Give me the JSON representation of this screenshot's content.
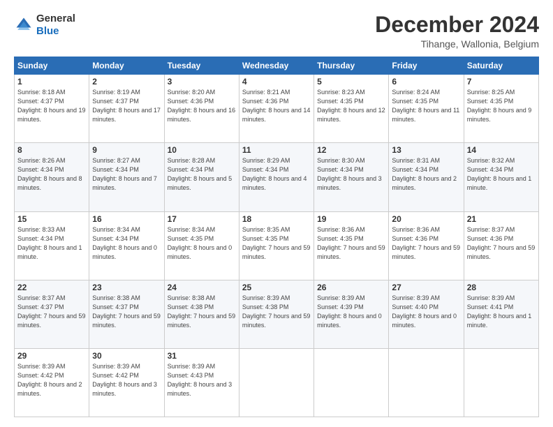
{
  "logo": {
    "general": "General",
    "blue": "Blue"
  },
  "header": {
    "month": "December 2024",
    "location": "Tihange, Wallonia, Belgium"
  },
  "days_of_week": [
    "Sunday",
    "Monday",
    "Tuesday",
    "Wednesday",
    "Thursday",
    "Friday",
    "Saturday"
  ],
  "weeks": [
    [
      {
        "day": "1",
        "sunrise": "8:18 AM",
        "sunset": "4:37 PM",
        "daylight": "8 hours and 19 minutes."
      },
      {
        "day": "2",
        "sunrise": "8:19 AM",
        "sunset": "4:37 PM",
        "daylight": "8 hours and 17 minutes."
      },
      {
        "day": "3",
        "sunrise": "8:20 AM",
        "sunset": "4:36 PM",
        "daylight": "8 hours and 16 minutes."
      },
      {
        "day": "4",
        "sunrise": "8:21 AM",
        "sunset": "4:36 PM",
        "daylight": "8 hours and 14 minutes."
      },
      {
        "day": "5",
        "sunrise": "8:23 AM",
        "sunset": "4:35 PM",
        "daylight": "8 hours and 12 minutes."
      },
      {
        "day": "6",
        "sunrise": "8:24 AM",
        "sunset": "4:35 PM",
        "daylight": "8 hours and 11 minutes."
      },
      {
        "day": "7",
        "sunrise": "8:25 AM",
        "sunset": "4:35 PM",
        "daylight": "8 hours and 9 minutes."
      }
    ],
    [
      {
        "day": "8",
        "sunrise": "8:26 AM",
        "sunset": "4:34 PM",
        "daylight": "8 hours and 8 minutes."
      },
      {
        "day": "9",
        "sunrise": "8:27 AM",
        "sunset": "4:34 PM",
        "daylight": "8 hours and 7 minutes."
      },
      {
        "day": "10",
        "sunrise": "8:28 AM",
        "sunset": "4:34 PM",
        "daylight": "8 hours and 5 minutes."
      },
      {
        "day": "11",
        "sunrise": "8:29 AM",
        "sunset": "4:34 PM",
        "daylight": "8 hours and 4 minutes."
      },
      {
        "day": "12",
        "sunrise": "8:30 AM",
        "sunset": "4:34 PM",
        "daylight": "8 hours and 3 minutes."
      },
      {
        "day": "13",
        "sunrise": "8:31 AM",
        "sunset": "4:34 PM",
        "daylight": "8 hours and 2 minutes."
      },
      {
        "day": "14",
        "sunrise": "8:32 AM",
        "sunset": "4:34 PM",
        "daylight": "8 hours and 1 minute."
      }
    ],
    [
      {
        "day": "15",
        "sunrise": "8:33 AM",
        "sunset": "4:34 PM",
        "daylight": "8 hours and 1 minute."
      },
      {
        "day": "16",
        "sunrise": "8:34 AM",
        "sunset": "4:34 PM",
        "daylight": "8 hours and 0 minutes."
      },
      {
        "day": "17",
        "sunrise": "8:34 AM",
        "sunset": "4:35 PM",
        "daylight": "8 hours and 0 minutes."
      },
      {
        "day": "18",
        "sunrise": "8:35 AM",
        "sunset": "4:35 PM",
        "daylight": "7 hours and 59 minutes."
      },
      {
        "day": "19",
        "sunrise": "8:36 AM",
        "sunset": "4:35 PM",
        "daylight": "7 hours and 59 minutes."
      },
      {
        "day": "20",
        "sunrise": "8:36 AM",
        "sunset": "4:36 PM",
        "daylight": "7 hours and 59 minutes."
      },
      {
        "day": "21",
        "sunrise": "8:37 AM",
        "sunset": "4:36 PM",
        "daylight": "7 hours and 59 minutes."
      }
    ],
    [
      {
        "day": "22",
        "sunrise": "8:37 AM",
        "sunset": "4:37 PM",
        "daylight": "7 hours and 59 minutes."
      },
      {
        "day": "23",
        "sunrise": "8:38 AM",
        "sunset": "4:37 PM",
        "daylight": "7 hours and 59 minutes."
      },
      {
        "day": "24",
        "sunrise": "8:38 AM",
        "sunset": "4:38 PM",
        "daylight": "7 hours and 59 minutes."
      },
      {
        "day": "25",
        "sunrise": "8:39 AM",
        "sunset": "4:38 PM",
        "daylight": "7 hours and 59 minutes."
      },
      {
        "day": "26",
        "sunrise": "8:39 AM",
        "sunset": "4:39 PM",
        "daylight": "8 hours and 0 minutes."
      },
      {
        "day": "27",
        "sunrise": "8:39 AM",
        "sunset": "4:40 PM",
        "daylight": "8 hours and 0 minutes."
      },
      {
        "day": "28",
        "sunrise": "8:39 AM",
        "sunset": "4:41 PM",
        "daylight": "8 hours and 1 minute."
      }
    ],
    [
      {
        "day": "29",
        "sunrise": "8:39 AM",
        "sunset": "4:42 PM",
        "daylight": "8 hours and 2 minutes."
      },
      {
        "day": "30",
        "sunrise": "8:39 AM",
        "sunset": "4:42 PM",
        "daylight": "8 hours and 3 minutes."
      },
      {
        "day": "31",
        "sunrise": "8:39 AM",
        "sunset": "4:43 PM",
        "daylight": "8 hours and 3 minutes."
      },
      null,
      null,
      null,
      null
    ]
  ]
}
